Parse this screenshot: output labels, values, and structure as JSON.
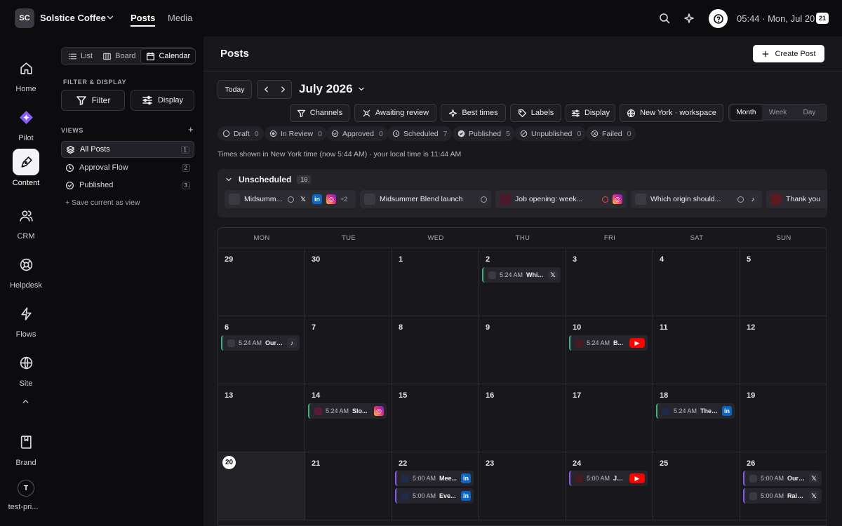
{
  "topbar": {
    "workspace_initials": "SC",
    "workspace_name": "Solstice Coffee",
    "tabs": [
      "Posts",
      "Media"
    ],
    "clock": "05:44 · Mon, Jul 20",
    "calendar_badge": "21"
  },
  "rail": {
    "items": [
      "Home",
      "Pilot",
      "Content",
      "CRM",
      "Helpdesk",
      "Flows",
      "Site",
      "Brand"
    ],
    "user_initial": "T",
    "user_name": "test-pri..."
  },
  "side": {
    "views_switch": [
      "List",
      "Board",
      "Calendar"
    ],
    "filter_heading": "FILTER & DISPLAY",
    "filter_label": "Filter",
    "display_label": "Display",
    "views_heading": "VIEWS",
    "views": [
      {
        "label": "All Posts",
        "count": "1"
      },
      {
        "label": "Approval Flow",
        "count": "2"
      },
      {
        "label": "Published",
        "count": "3"
      }
    ],
    "save_view": "+ Save current as view"
  },
  "main": {
    "title": "Posts",
    "create_label": "Create Post",
    "today_label": "Today",
    "month_label": "July 2026",
    "toolbar": [
      "Channels",
      "Awaiting review",
      "Best times",
      "Labels",
      "Display",
      "New York · workspace"
    ],
    "range": [
      "Month",
      "Week",
      "Day"
    ],
    "statuses": [
      {
        "label": "Draft",
        "count": "0"
      },
      {
        "label": "In Review",
        "count": "0"
      },
      {
        "label": "Approved",
        "count": "0"
      },
      {
        "label": "Scheduled",
        "count": "7"
      },
      {
        "label": "Published",
        "count": "5"
      },
      {
        "label": "Unpublished",
        "count": "0"
      },
      {
        "label": "Failed",
        "count": "0"
      }
    ],
    "tz_note": "Times shown in New York time (now 5:44 AM) · your local time is 11:44 AM"
  },
  "unscheduled": {
    "title": "Unscheduled",
    "count": "16",
    "cards": [
      {
        "title": "Midsumm...",
        "more": "+2"
      },
      {
        "title": "Midsummer Blend launch"
      },
      {
        "title": "Job opening: week..."
      },
      {
        "title": "Which origin should..."
      },
      {
        "title": "Thank you"
      }
    ]
  },
  "calendar": {
    "weekdays": [
      "MON",
      "TUE",
      "WED",
      "THU",
      "FRI",
      "SAT",
      "SUN"
    ],
    "days": [
      "29",
      "30",
      "1",
      "2",
      "3",
      "4",
      "5",
      "6",
      "7",
      "8",
      "9",
      "10",
      "11",
      "12",
      "13",
      "14",
      "15",
      "16",
      "17",
      "18",
      "19",
      "20",
      "21",
      "22",
      "23",
      "24",
      "25",
      "26"
    ],
    "events": {
      "e1": {
        "time": "5:24 AM",
        "title": "Whi..."
      },
      "e2": {
        "time": "5:24 AM",
        "title": "Our ..."
      },
      "e3": {
        "time": "5:24 AM",
        "title": "B..."
      },
      "e4": {
        "time": "5:24 AM",
        "title": "Slo..."
      },
      "e5": {
        "time": "5:24 AM",
        "title": "The ..."
      },
      "e6": {
        "time": "5:00 AM",
        "title": "Mee..."
      },
      "e7": {
        "time": "5:00 AM",
        "title": "Eve..."
      },
      "e8": {
        "time": "5:00 AM",
        "title": "Jo..."
      },
      "e9": {
        "time": "5:00 AM",
        "title": "Our ..."
      },
      "e10": {
        "time": "5:00 AM",
        "title": "Rain..."
      }
    }
  },
  "colors": {
    "accent_green": "#3fb27f",
    "accent_purple": "#8a5cf6",
    "youtube": "#ff0000",
    "linkedin": "#0a66c2",
    "failed": "#e5484d"
  }
}
